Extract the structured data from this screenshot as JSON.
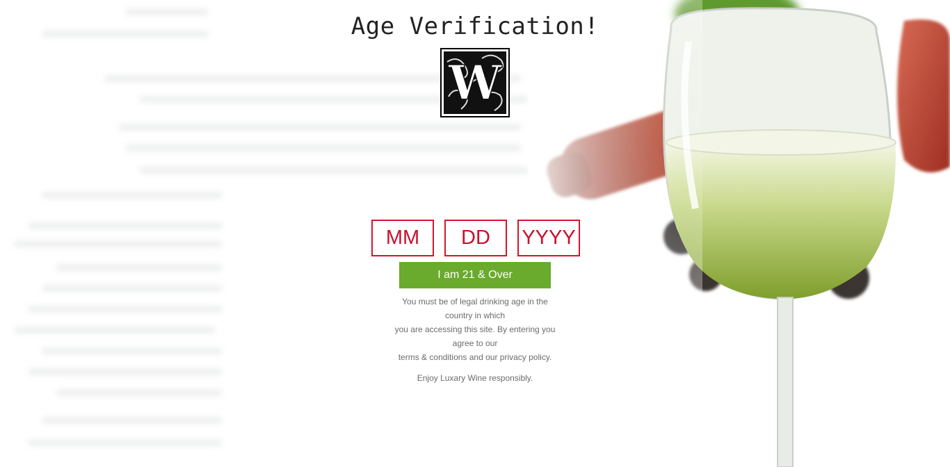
{
  "page": {
    "title": "Age Verification!",
    "logo": {
      "icon": "ornate-letter-w-logo",
      "letter": "W"
    }
  },
  "form": {
    "month_placeholder": "MM",
    "day_placeholder": "DD",
    "year_placeholder": "YYYY",
    "submit_label": "I am 21 & Over"
  },
  "disclaimer": {
    "line1": "You must be of legal drinking age in the country in which",
    "line2": "you are accessing this site. By entering you agree to our",
    "line3": "terms & conditions and our privacy policy.",
    "enjoy": "Enjoy Luxary Wine responsibly."
  },
  "colors": {
    "accent_red": "#d2152e",
    "button_green": "#6aaa2d",
    "text_gray": "#6b6b6b"
  }
}
